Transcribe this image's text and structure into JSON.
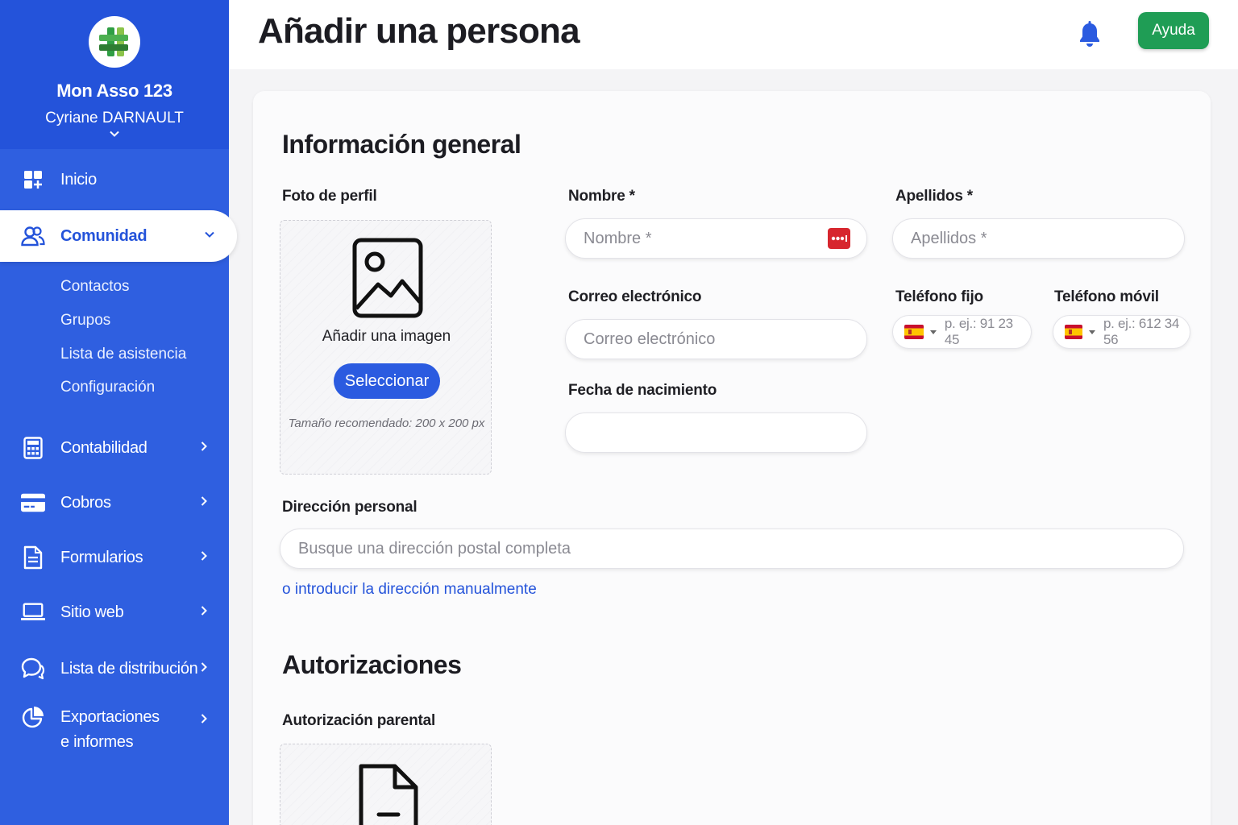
{
  "sidebar": {
    "org_name": "Mon Asso 123",
    "user_name": "Cyriane DARNAULT",
    "items": {
      "inicio": "Inicio",
      "comunidad": "Comunidad",
      "contabilidad": "Contabilidad",
      "cobros": "Cobros",
      "formularios": "Formularios",
      "sitio_web": "Sitio web",
      "lista_distribucion": "Lista de distribución",
      "exportaciones_1": "Exportaciones",
      "exportaciones_2": "e informes"
    },
    "sub_items": {
      "contactos": "Contactos",
      "grupos": "Grupos",
      "lista_asistencia": "Lista de asistencia",
      "configuracion": "Configuración"
    }
  },
  "header": {
    "title": "Añadir una persona",
    "help_label": "Ayuda"
  },
  "form": {
    "section_general": "Información general",
    "photo_label": "Foto de perfil",
    "photo_add_text": "Añadir una imagen",
    "photo_select_button": "Seleccionar",
    "photo_hint": "Tamaño recomendado: 200 x 200 px",
    "nombre_label": "Nombre *",
    "nombre_placeholder": "Nombre *",
    "apellidos_label": "Apellidos *",
    "apellidos_placeholder": "Apellidos *",
    "correo_label": "Correo electrónico",
    "correo_placeholder": "Correo electrónico",
    "telefono_fijo_label": "Teléfono fijo",
    "telefono_fijo_placeholder": "p. ej.: 91 23 45",
    "telefono_movil_label": "Teléfono móvil",
    "telefono_movil_placeholder": "p. ej.: 612 34 56",
    "fecha_label": "Fecha de nacimiento",
    "fecha_value": "",
    "direccion_label": "Dirección personal",
    "direccion_placeholder": "Busque una dirección postal completa",
    "direccion_manual_link": "o introducir la dirección manualmente",
    "section_autorizaciones": "Autorizaciones",
    "autorizacion_parental_label": "Autorización parental"
  },
  "colors": {
    "sidebar": "#2f5fe0",
    "sidebar_header": "#2453da",
    "primary": "#2b5be0",
    "help_green": "#1f9d55"
  }
}
